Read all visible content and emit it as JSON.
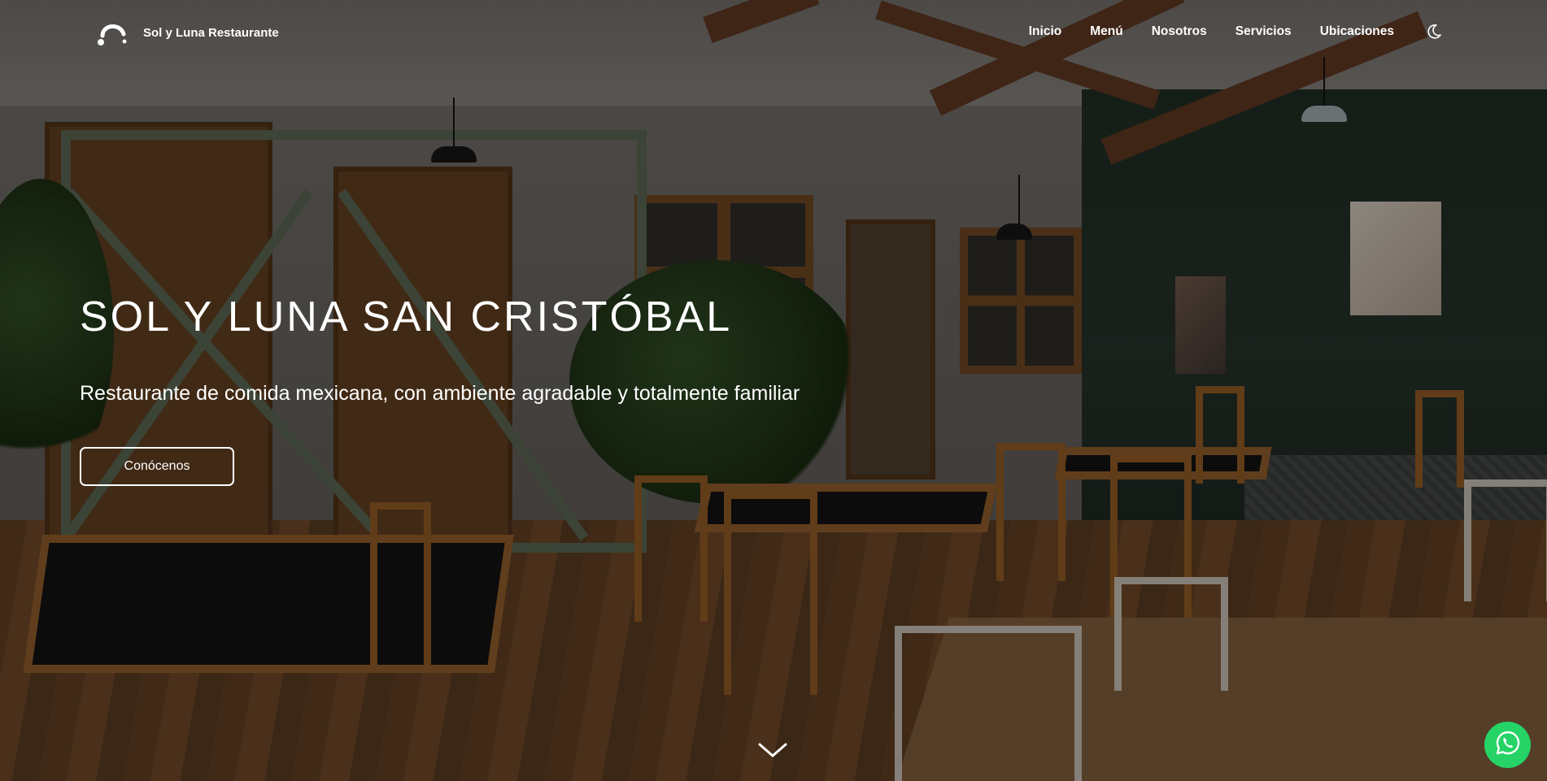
{
  "header": {
    "brand_name": "Sol y Luna Restaurante",
    "nav_items": [
      {
        "label": "Inicio"
      },
      {
        "label": "Menú"
      },
      {
        "label": "Nosotros"
      },
      {
        "label": "Servicios"
      },
      {
        "label": "Ubicaciones"
      }
    ],
    "theme_toggle_icon": "moon-icon"
  },
  "hero": {
    "title": "SOL Y LUNA SAN CRISTÓBAL",
    "subtitle": "Restaurante de comida mexicana, con ambiente agradable y totalmente familiar",
    "cta_label": "Conócenos",
    "scroll_icon": "chevron-down-icon"
  },
  "floating": {
    "whatsapp_icon": "whatsapp-icon"
  },
  "colors": {
    "whatsapp_green": "#25d366",
    "text": "#ffffff"
  }
}
